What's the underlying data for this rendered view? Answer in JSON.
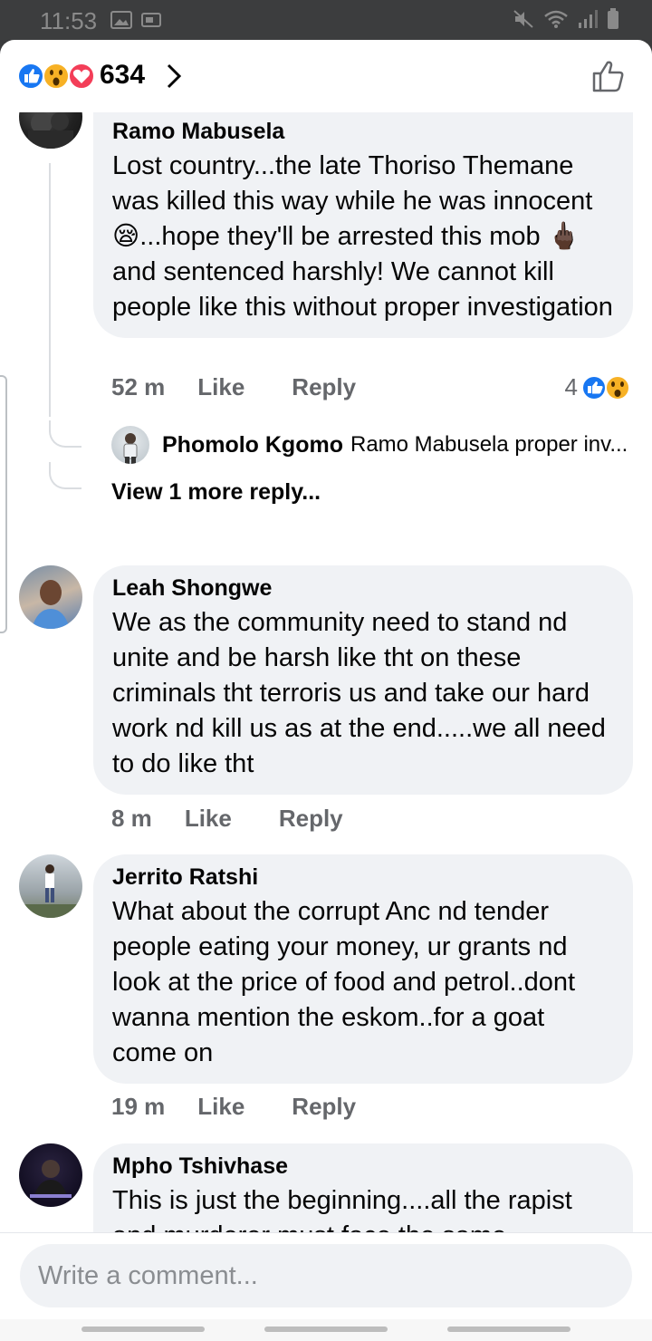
{
  "status_bar": {
    "time": "11:53"
  },
  "header": {
    "reaction_count": "634"
  },
  "comments": [
    {
      "name": "Ramo Mabusela",
      "text": "Lost country...the late Thoriso Themane was killed this way while he was innocent 😪...hope they'll be arrested this mob 🖕🏿 and sentenced harshly! We cannot kill people like this without proper investigation",
      "time": "52 m",
      "like": "Like",
      "reply": "Reply",
      "reaction_count": "4",
      "reply_preview": {
        "name": "Phomolo Kgomo",
        "text": "Ramo Mabusela proper inv..."
      },
      "more_replies": "View 1 more reply..."
    },
    {
      "name": "Leah Shongwe",
      "text": "We as the community need to stand nd unite and be harsh like tht on these criminals tht terroris us and take our hard work nd kill us as at the end.....we all need to do like tht",
      "time": "8 m",
      "like": "Like",
      "reply": "Reply"
    },
    {
      "name": "Jerrito Ratshi",
      "text": "What about the corrupt Anc nd tender people eating your money, ur grants nd look at the price of food and petrol..dont wanna mention the eskom..for a goat come on",
      "time": "19 m",
      "like": "Like",
      "reply": "Reply"
    },
    {
      "name": "Mpho Tshivhase",
      "text": "This is just the beginning....all the rapist and murderer must face the same thing...let's resist crime by all"
    }
  ],
  "composer": {
    "placeholder": "Write a comment..."
  },
  "icons": {
    "reactions": [
      "like-icon",
      "wow-icon",
      "love-icon"
    ],
    "header_like": "thumbs-up-outline-icon"
  },
  "colors": {
    "like_blue": "#1877f2",
    "love_red": "#f33e58",
    "wow_yellow": "#f7b125",
    "bubble": "#f0f2f5"
  }
}
